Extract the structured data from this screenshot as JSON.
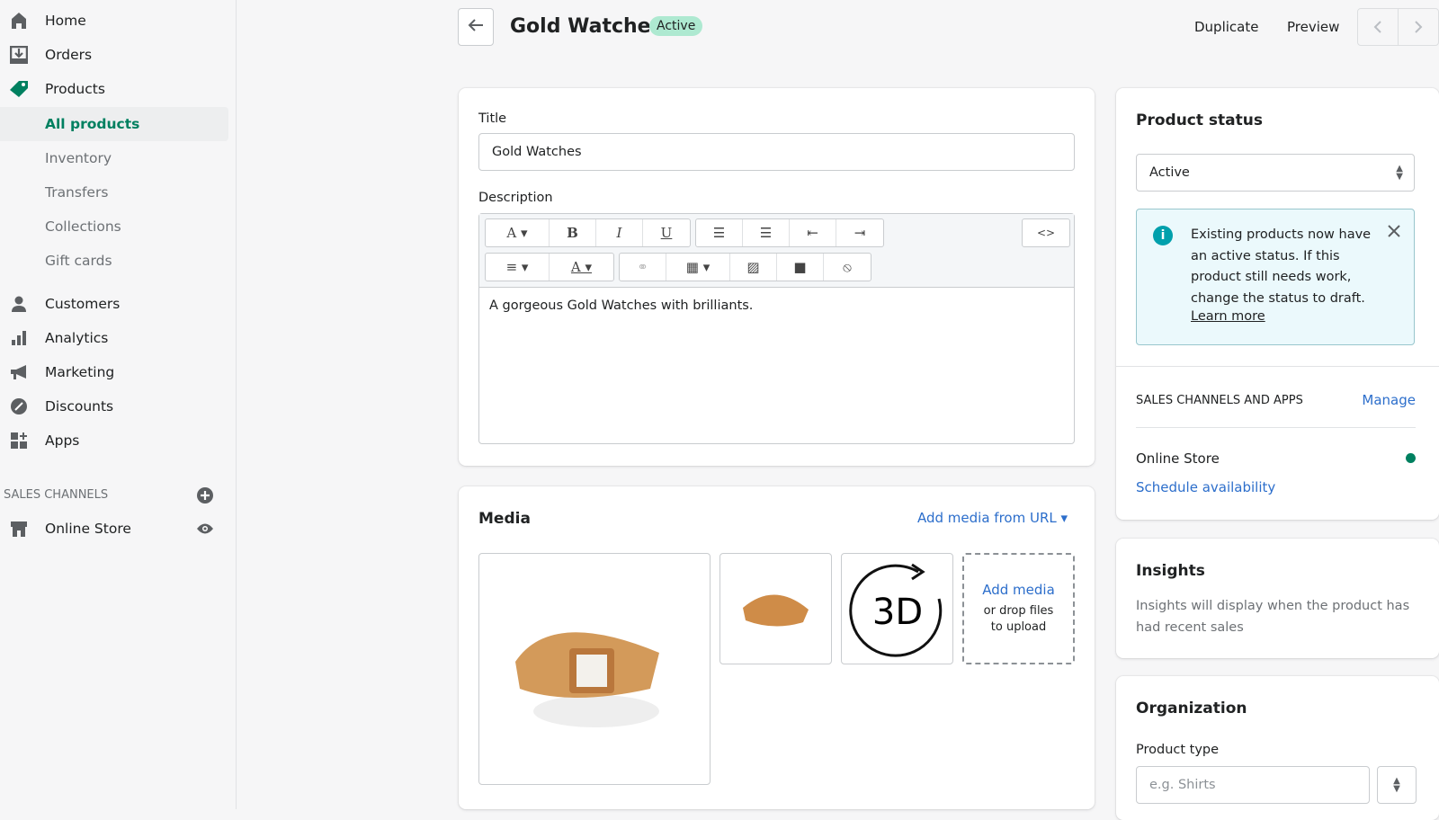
{
  "sidebar": {
    "items": [
      {
        "label": "Home",
        "icon": "home-icon"
      },
      {
        "label": "Orders",
        "icon": "orders-icon"
      },
      {
        "label": "Products",
        "icon": "tag-icon"
      },
      {
        "label": "All products"
      },
      {
        "label": "Inventory"
      },
      {
        "label": "Transfers"
      },
      {
        "label": "Collections"
      },
      {
        "label": "Gift cards"
      },
      {
        "label": "Customers",
        "icon": "person-icon"
      },
      {
        "label": "Analytics",
        "icon": "bar-chart-icon"
      },
      {
        "label": "Marketing",
        "icon": "megaphone-icon"
      },
      {
        "label": "Discounts",
        "icon": "discount-icon"
      },
      {
        "label": "Apps",
        "icon": "apps-icon"
      }
    ],
    "sales_channels_label": "SALES CHANNELS",
    "online_store": "Online Store"
  },
  "header": {
    "title": "Gold Watches",
    "status": "Active",
    "duplicate": "Duplicate",
    "preview": "Preview"
  },
  "main": {
    "title_label": "Title",
    "title_value": "Gold Watches",
    "description_label": "Description",
    "description_text": "A gorgeous Gold Watches with brilliants.",
    "code_button": "<>",
    "media": {
      "heading": "Media",
      "add_url": "Add media from URL",
      "add_media": "Add media",
      "drop_text": "or drop files to upload",
      "three_d": "3D"
    }
  },
  "status_card": {
    "heading": "Product status",
    "selected": "Active",
    "banner": "Existing products now have an active status. If this product still needs work, change the status to draft.",
    "learn_more": "Learn more",
    "channels_heading": "SALES CHANNELS AND APPS",
    "manage": "Manage",
    "online_store": "Online Store",
    "schedule": "Schedule availability"
  },
  "insights": {
    "heading": "Insights",
    "text": "Insights will display when the product has had recent sales"
  },
  "organization": {
    "heading": "Organization",
    "product_type_label": "Product type",
    "product_type_placeholder": "e.g. Shirts"
  },
  "colors": {
    "accent": "#008060",
    "link": "#2c6ecb",
    "banner_bg": "#ebf9fc"
  }
}
